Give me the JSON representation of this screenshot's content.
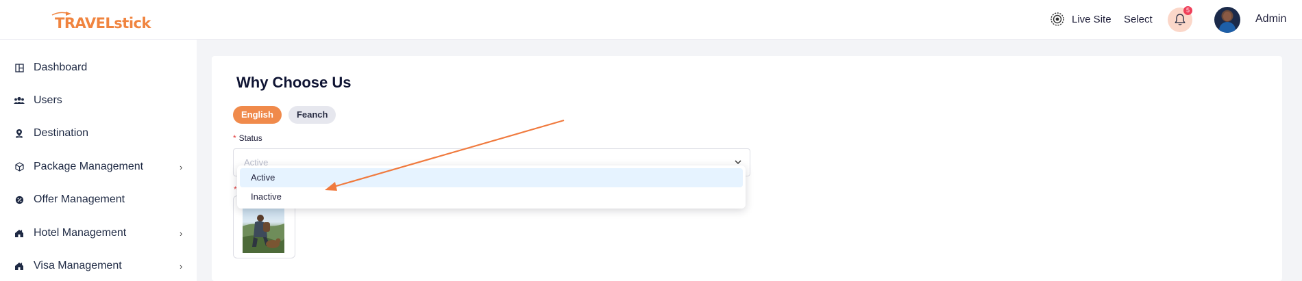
{
  "brand": {
    "logo_text": "TRAVELstick",
    "accent": "#f08a4b"
  },
  "header": {
    "live_site_label": "Live Site",
    "select_label": "Select",
    "notification_count": "5",
    "user_label": "Admin"
  },
  "sidebar": {
    "items": [
      {
        "label": "Dashboard",
        "icon": "dashboard-icon",
        "has_submenu": false
      },
      {
        "label": "Users",
        "icon": "users-icon",
        "has_submenu": false
      },
      {
        "label": "Destination",
        "icon": "location-pin-icon",
        "has_submenu": false
      },
      {
        "label": "Package Management",
        "icon": "package-icon",
        "has_submenu": true,
        "chevron": "›"
      },
      {
        "label": "Offer Management",
        "icon": "offer-icon",
        "has_submenu": false
      },
      {
        "label": "Hotel Management",
        "icon": "hotel-icon",
        "has_submenu": true,
        "chevron": "›"
      },
      {
        "label": "Visa Management",
        "icon": "visa-icon",
        "has_submenu": true,
        "chevron": "›"
      }
    ]
  },
  "main": {
    "title": "Why Choose Us",
    "tabs": [
      {
        "label": "English",
        "active": true
      },
      {
        "label": "Feanch",
        "active": false
      }
    ],
    "status_field": {
      "required_mark": "*",
      "label": "Status",
      "value": "Active"
    },
    "image_field": {
      "required_mark": "*"
    },
    "dropdown": {
      "options": [
        {
          "label": "Active",
          "selected": true
        },
        {
          "label": "Inactive",
          "selected": false
        }
      ]
    }
  },
  "colors": {
    "annotation_arrow": "#f07a3e",
    "notification_badge": "#ef3f5a"
  }
}
